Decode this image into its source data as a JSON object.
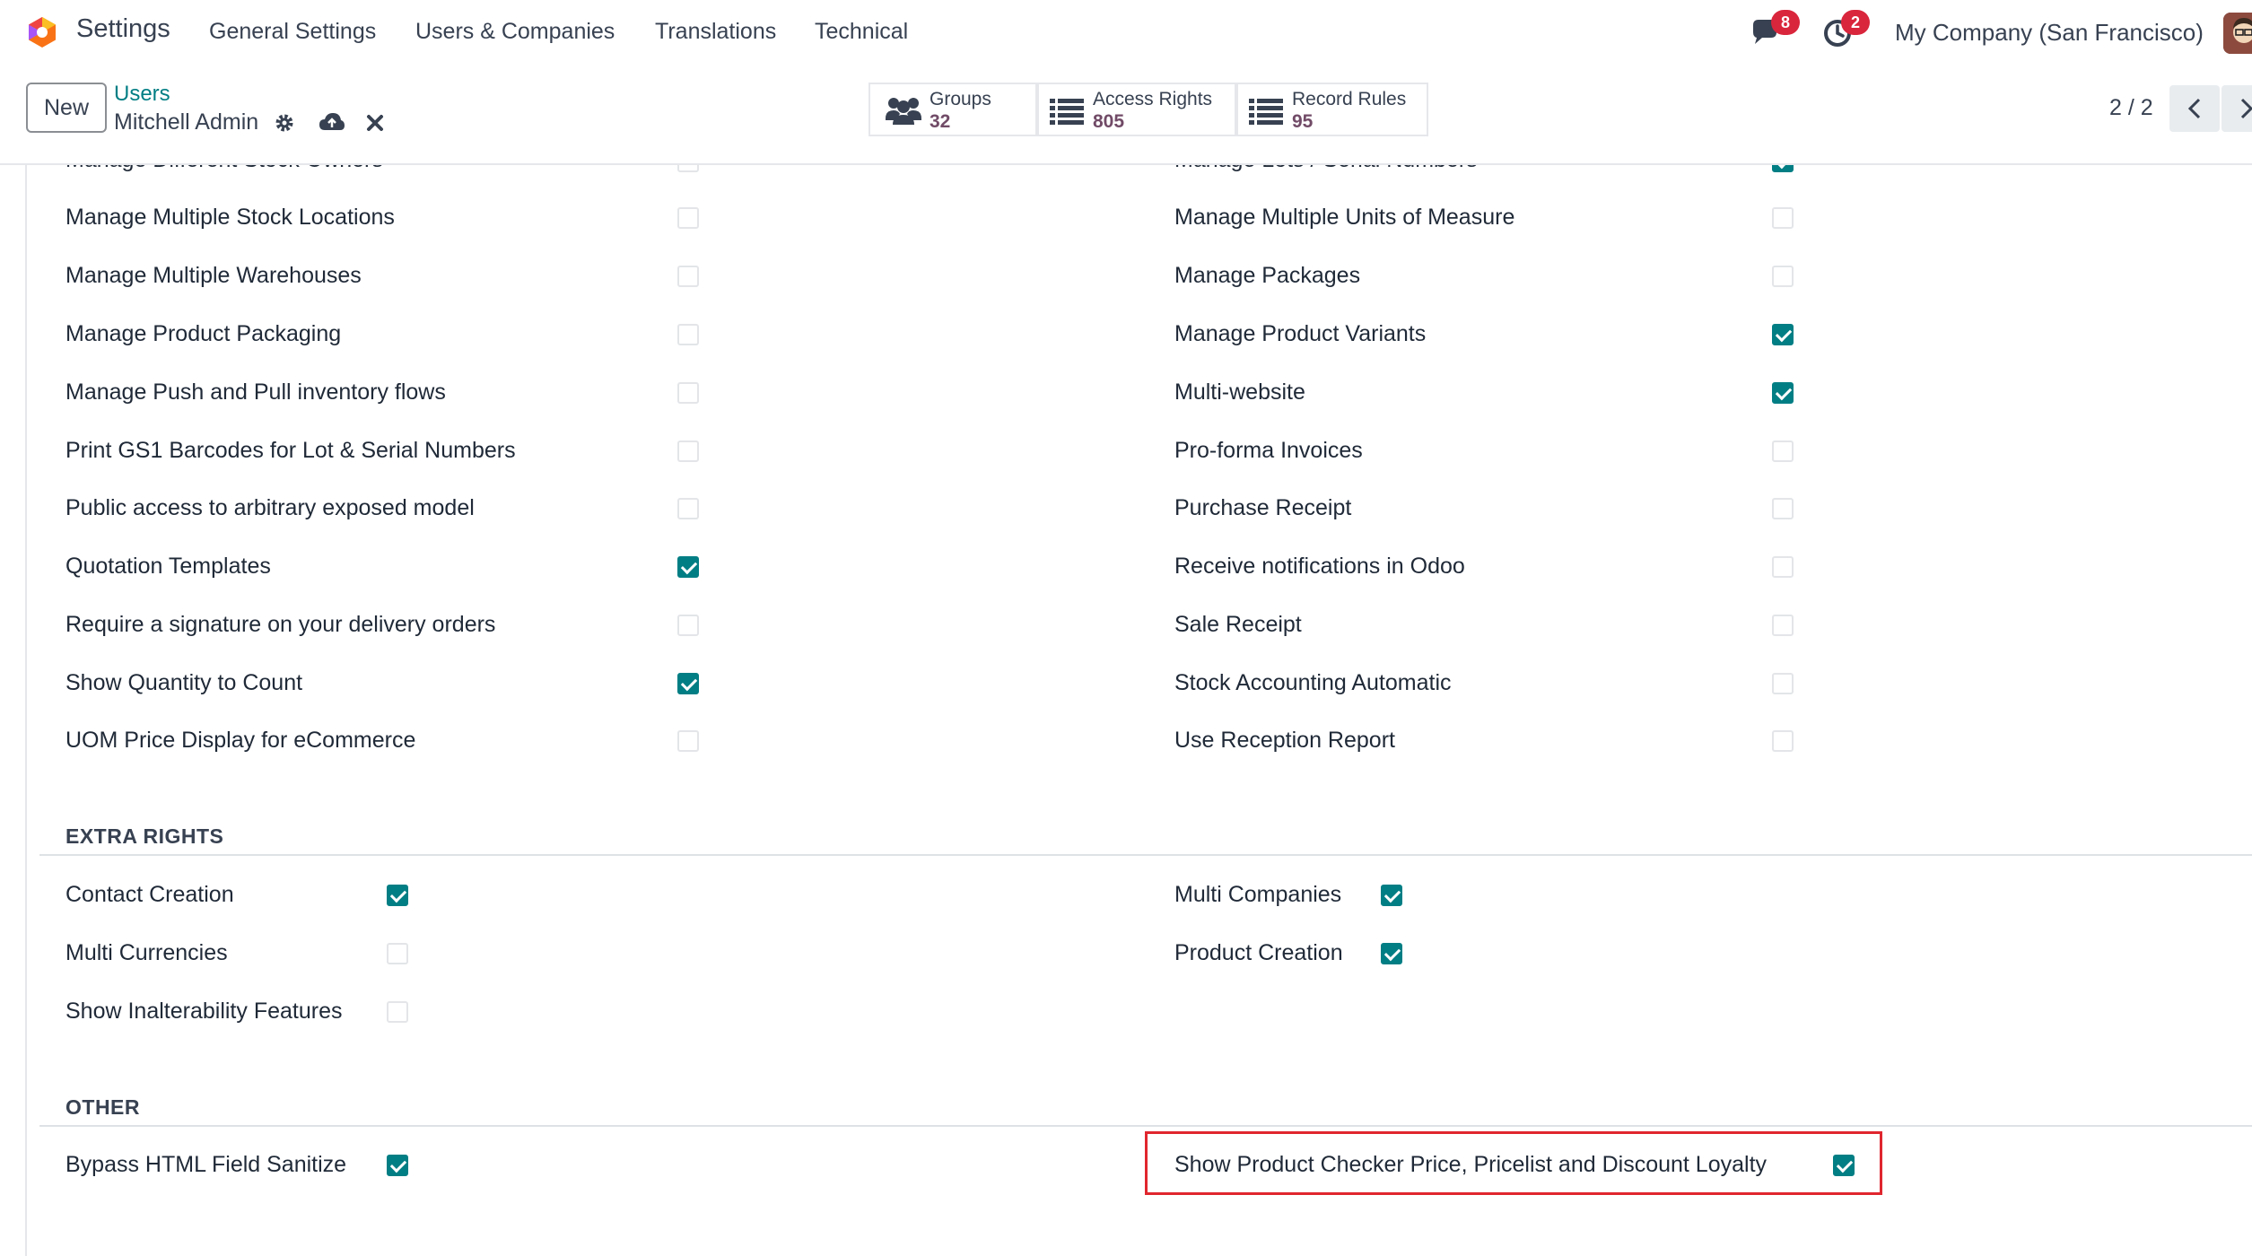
{
  "navbar": {
    "app_name": "Settings",
    "menus": [
      "General Settings",
      "Users & Companies",
      "Translations",
      "Technical"
    ],
    "messages_count": "8",
    "activities_count": "2",
    "company": "My Company (San Francisco)",
    "brand_colors": {
      "accent": "#017e84",
      "primary": "#714b67",
      "badge": "#d9263c"
    }
  },
  "control_panel": {
    "new_label": "New",
    "breadcrumb": {
      "parent": "Users",
      "current": "Mitchell Admin"
    },
    "smart_buttons": [
      {
        "label": "Groups",
        "value": "32"
      },
      {
        "label": "Access Rights",
        "value": "805"
      },
      {
        "label": "Record Rules",
        "value": "95"
      }
    ],
    "pager": "2 / 2"
  },
  "technical_rights": {
    "left": [
      {
        "label": "Manage Different Stock Owners",
        "checked": false
      },
      {
        "label": "Manage Multiple Stock Locations",
        "checked": false
      },
      {
        "label": "Manage Multiple Warehouses",
        "checked": false
      },
      {
        "label": "Manage Product Packaging",
        "checked": false
      },
      {
        "label": "Manage Push and Pull inventory flows",
        "checked": false
      },
      {
        "label": "Print GS1 Barcodes for Lot & Serial Numbers",
        "checked": false
      },
      {
        "label": "Public access to arbitrary exposed model",
        "checked": false
      },
      {
        "label": "Quotation Templates",
        "checked": true
      },
      {
        "label": "Require a signature on your delivery orders",
        "checked": false
      },
      {
        "label": "Show Quantity to Count",
        "checked": true
      },
      {
        "label": "UOM Price Display for eCommerce",
        "checked": false
      }
    ],
    "right": [
      {
        "label": "Manage Lots / Serial Numbers",
        "checked": true
      },
      {
        "label": "Manage Multiple Units of Measure",
        "checked": false
      },
      {
        "label": "Manage Packages",
        "checked": false
      },
      {
        "label": "Manage Product Variants",
        "checked": true
      },
      {
        "label": "Multi-website",
        "checked": true
      },
      {
        "label": "Pro-forma Invoices",
        "checked": false
      },
      {
        "label": "Purchase Receipt",
        "checked": false
      },
      {
        "label": "Receive notifications in Odoo",
        "checked": false
      },
      {
        "label": "Sale Receipt",
        "checked": false
      },
      {
        "label": "Stock Accounting Automatic",
        "checked": false
      },
      {
        "label": "Use Reception Report",
        "checked": false
      }
    ]
  },
  "extra_rights": {
    "title": "EXTRA RIGHTS",
    "left": [
      {
        "label": "Contact Creation",
        "checked": true
      },
      {
        "label": "Multi Currencies",
        "checked": false
      },
      {
        "label": "Show Inalterability Features",
        "checked": false
      }
    ],
    "right": [
      {
        "label": "Multi Companies",
        "checked": true
      },
      {
        "label": "Product Creation",
        "checked": true
      }
    ]
  },
  "other": {
    "title": "OTHER",
    "left": [
      {
        "label": "Bypass HTML Field Sanitize",
        "checked": true
      }
    ],
    "right": [
      {
        "label": "Show Product Checker Price, Pricelist and Discount Loyalty",
        "checked": true
      }
    ]
  }
}
